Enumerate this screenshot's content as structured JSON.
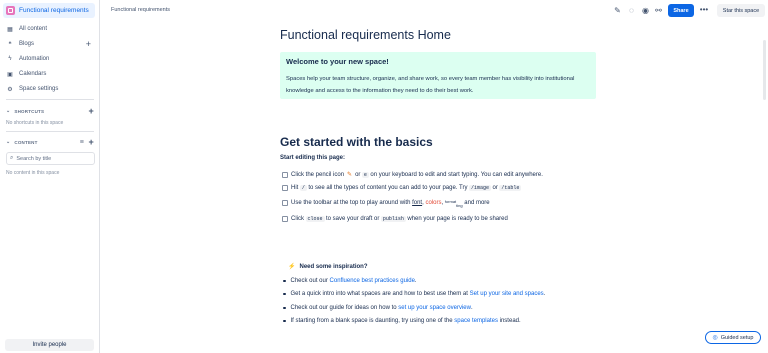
{
  "sidebar": {
    "space_name": "Functional requirements",
    "items": [
      {
        "label": "All content",
        "icon": "grid-icon"
      },
      {
        "label": "Blogs",
        "icon": "quote-icon"
      },
      {
        "label": "Automation",
        "icon": "lightning-icon"
      },
      {
        "label": "Calendars",
        "icon": "calendar-icon"
      },
      {
        "label": "Space settings",
        "icon": "gear-icon"
      }
    ],
    "shortcuts_label": "SHORTCUTS",
    "shortcuts_empty": "No shortcuts in this space",
    "content_label": "CONTENT",
    "filter_placeholder": "Search by title",
    "content_empty": "No content in this space",
    "invite_label": "Invite people"
  },
  "topbar": {
    "breadcrumb": "Functional requirements",
    "share_label": "Share",
    "more_label": "•••",
    "star_label": "Star this space"
  },
  "page": {
    "title": "Functional requirements Home",
    "panel_title": "Welcome to your new space!",
    "panel_text": "Spaces help your team structure, organize, and share work, so every team member has visibility into institutional knowledge and access to the information they need to do their best work.",
    "heading": "Get started with the basics",
    "subheading": "Start editing this page:",
    "tasks": {
      "t1_a": "Click the pencil icon",
      "t1_b": "or",
      "t1_code": "e",
      "t1_c": "on your keyboard to edit and start typing. You can edit anywhere.",
      "t2_a": "Hit",
      "t2_code1": "/",
      "t2_b": "to see all the types of content you can add to your page. Try",
      "t2_code2": "/image",
      "t2_c": "or",
      "t2_code3": "/table",
      "t3_a": "Use the toolbar at the top to play around with",
      "t3_font": "font",
      "t3_comma": ",",
      "t3_colors": "colors",
      "t3_comma2": ",",
      "t3_format_a": "format",
      "t3_format_b": "ting",
      "t3_b": "and more",
      "t4_a": "Click",
      "t4_code1": "close",
      "t4_b": "to save your draft or",
      "t4_code2": "publish",
      "t4_c": "when your page is ready to be shared"
    },
    "inspiration_title": "Need some inspiration?",
    "bullets": {
      "b1_a": "Check out our",
      "b1_link": "Confluence best practices guide",
      "b1_b": ".",
      "b2_a": "Get a quick intro into what spaces are and how to best use them at",
      "b2_link": "Set up your site and spaces",
      "b2_b": ".",
      "b3_a": "Check out our guide for ideas on how to",
      "b3_link": "set up your space overview",
      "b3_b": ".",
      "b4_a": "If starting from a blank space is daunting, try using one of the",
      "b4_link": "space templates",
      "b4_b": "instead."
    }
  },
  "guided_setup_label": "Guided setup",
  "colors": {
    "accent": "#0c66e4",
    "panel": "#dcfff1",
    "space_logo": "#e774bb"
  }
}
